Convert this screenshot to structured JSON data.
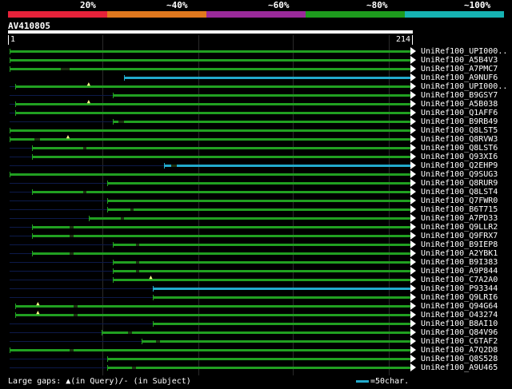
{
  "legend": {
    "segments": [
      {
        "label": "20%",
        "color": "#e6223a"
      },
      {
        "label": "~40%",
        "color": "#e0781e"
      },
      {
        "label": "~60%",
        "color": "#9a2a9a"
      },
      {
        "label": "~80%",
        "color": "#1d9b1d"
      },
      {
        "label": "~100%",
        "color": "#16b3b3"
      }
    ]
  },
  "query": {
    "name": "AV410805",
    "start_label": "1",
    "end_label": "214",
    "length": 214
  },
  "colors": {
    "green": "#21a021",
    "cyan": "#22aacc",
    "query_bar": "#ffffff",
    "background": "#000000"
  },
  "hits": [
    {
      "label": "UniRef100_UPI000..",
      "start": 1,
      "end": 214,
      "color": "green",
      "thin_start": null,
      "gaps": []
    },
    {
      "label": "UniRef100_A5B4V3",
      "start": 1,
      "end": 214,
      "color": "green",
      "thin_start": null,
      "gaps": []
    },
    {
      "label": "UniRef100_A7PMC7",
      "start": 1,
      "end": 214,
      "color": "green",
      "thin_start": null,
      "gaps": [
        [
          28,
          33
        ]
      ]
    },
    {
      "label": "UniRef100_A9NUF6",
      "start": 62,
      "end": 214,
      "color": "cyan",
      "thin_start": null,
      "gaps": []
    },
    {
      "label": "UniRef100_UPI000..",
      "start": 4,
      "end": 214,
      "color": "green",
      "thin_start": 1,
      "gaps": [],
      "tri": [
        43
      ]
    },
    {
      "label": "UniRef100_B9GSY7",
      "start": 56,
      "end": 214,
      "color": "green",
      "thin_start": 1,
      "gaps": []
    },
    {
      "label": "UniRef100_A5B038",
      "start": 4,
      "end": 214,
      "color": "green",
      "thin_start": 1,
      "gaps": [],
      "tri": [
        43
      ]
    },
    {
      "label": "UniRef100_Q1AFF6",
      "start": 4,
      "end": 214,
      "color": "green",
      "thin_start": 1,
      "gaps": []
    },
    {
      "label": "UniRef100_B9RB49",
      "start": 56,
      "end": 214,
      "color": "green",
      "thin_start": 1,
      "gaps": [
        [
          59,
          62
        ]
      ]
    },
    {
      "label": "UniRef100_Q8LST5",
      "start": 1,
      "end": 214,
      "color": "green",
      "thin_start": null,
      "gaps": []
    },
    {
      "label": "UniRef100_Q8RVW3",
      "start": 1,
      "end": 214,
      "color": "green",
      "thin_start": null,
      "gaps": [
        [
          14,
          17
        ]
      ],
      "tri": [
        32
      ]
    },
    {
      "label": "UniRef100_Q8LST6",
      "start": 13,
      "end": 214,
      "color": "green",
      "thin_start": 1,
      "gaps": [
        [
          40,
          42
        ]
      ]
    },
    {
      "label": "UniRef100_Q93XI6",
      "start": 13,
      "end": 214,
      "color": "green",
      "thin_start": 1,
      "gaps": []
    },
    {
      "label": "UniRef100_Q2EHP9",
      "start": 83,
      "end": 214,
      "color": "cyan",
      "thin_start": 1,
      "gaps": [
        [
          87,
          90
        ]
      ]
    },
    {
      "label": "UniRef100_Q9SUG3",
      "start": 1,
      "end": 214,
      "color": "green",
      "thin_start": null,
      "gaps": []
    },
    {
      "label": "UniRef100_Q8RUR9",
      "start": 53,
      "end": 214,
      "color": "green",
      "thin_start": 1,
      "gaps": []
    },
    {
      "label": "UniRef100_Q8LST4",
      "start": 13,
      "end": 214,
      "color": "green",
      "thin_start": 1,
      "gaps": [
        [
          40,
          42
        ]
      ]
    },
    {
      "label": "UniRef100_Q7FWR0",
      "start": 53,
      "end": 214,
      "color": "green",
      "thin_start": 1,
      "gaps": []
    },
    {
      "label": "UniRef100_B6T715",
      "start": 53,
      "end": 214,
      "color": "green",
      "thin_start": 1,
      "gaps": [
        [
          65,
          67
        ]
      ]
    },
    {
      "label": "UniRef100_A7PD33",
      "start": 43,
      "end": 214,
      "color": "green",
      "thin_start": 1,
      "gaps": [
        [
          60,
          62
        ]
      ]
    },
    {
      "label": "UniRef100_Q9LLR2",
      "start": 13,
      "end": 214,
      "color": "green",
      "thin_start": 1,
      "gaps": [
        [
          33,
          35
        ]
      ]
    },
    {
      "label": "UniRef100_Q9FRX7",
      "start": 13,
      "end": 214,
      "color": "green",
      "thin_start": 1,
      "gaps": [
        [
          33,
          35
        ]
      ]
    },
    {
      "label": "UniRef100_B9IEP8",
      "start": 56,
      "end": 214,
      "color": "green",
      "thin_start": 1,
      "gaps": [
        [
          68,
          70
        ]
      ]
    },
    {
      "label": "UniRef100_A2YBK1",
      "start": 13,
      "end": 214,
      "color": "green",
      "thin_start": 1,
      "gaps": [
        [
          33,
          35
        ]
      ]
    },
    {
      "label": "UniRef100_B9I383",
      "start": 56,
      "end": 214,
      "color": "green",
      "thin_start": 1,
      "gaps": [
        [
          68,
          70
        ]
      ]
    },
    {
      "label": "UniRef100_A9P844",
      "start": 56,
      "end": 214,
      "color": "green",
      "thin_start": 1,
      "gaps": [
        [
          68,
          70
        ]
      ]
    },
    {
      "label": "UniRef100_C7A2A0",
      "start": 56,
      "end": 214,
      "color": "green",
      "thin_start": 1,
      "gaps": [],
      "tri": [
        76
      ]
    },
    {
      "label": "UniRef100_P93344",
      "start": 77,
      "end": 214,
      "color": "cyan",
      "thin_start": 1,
      "gaps": []
    },
    {
      "label": "UniRef100_Q9LRI6",
      "start": 77,
      "end": 214,
      "color": "green",
      "thin_start": 1,
      "gaps": []
    },
    {
      "label": "UniRef100_Q94G64",
      "start": 4,
      "end": 214,
      "color": "green",
      "thin_start": null,
      "gaps": [
        [
          35,
          37
        ]
      ],
      "tri": [
        16
      ]
    },
    {
      "label": "UniRef100_O43274",
      "start": 4,
      "end": 214,
      "color": "green",
      "thin_start": null,
      "gaps": [
        [
          35,
          37
        ]
      ],
      "tri": [
        16
      ]
    },
    {
      "label": "UniRef100_B8AI10",
      "start": 77,
      "end": 214,
      "color": "green",
      "thin_start": 1,
      "gaps": []
    },
    {
      "label": "UniRef100_Q84V96",
      "start": 50,
      "end": 214,
      "color": "green",
      "thin_start": 1,
      "gaps": [
        [
          64,
          66
        ]
      ]
    },
    {
      "label": "UniRef100_C6TAF2",
      "start": 71,
      "end": 214,
      "color": "green",
      "thin_start": 1,
      "gaps": [
        [
          79,
          81
        ]
      ]
    },
    {
      "label": "UniRef100_A7Q2D8",
      "start": 1,
      "end": 214,
      "color": "green",
      "thin_start": null,
      "gaps": [
        [
          33,
          35
        ]
      ]
    },
    {
      "label": "UniRef100_Q8S528",
      "start": 53,
      "end": 214,
      "color": "green",
      "thin_start": 1,
      "gaps": []
    },
    {
      "label": "UniRef100_A9U465",
      "start": 53,
      "end": 214,
      "color": "green",
      "thin_start": 1,
      "gaps": [
        [
          66,
          68
        ]
      ]
    }
  ],
  "footer": {
    "gaps_text": "Large gaps: ▲(in Query)/- (in Subject)",
    "scale_text": "=50char."
  }
}
